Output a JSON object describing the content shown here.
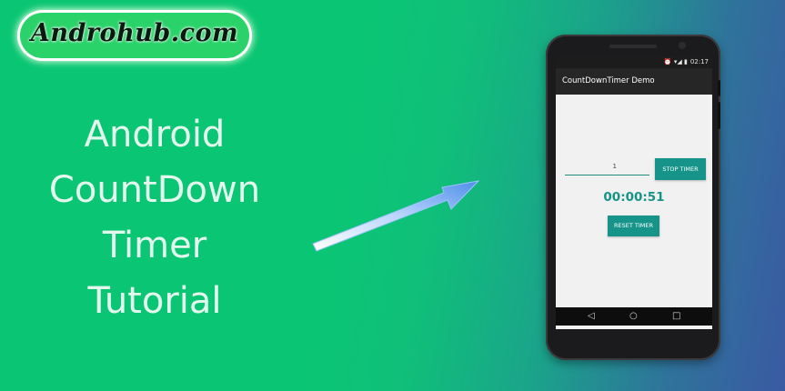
{
  "brand": {
    "logo_text": "Androhub.com"
  },
  "headline": {
    "lines": [
      "Android",
      "CountDown",
      "Timer",
      "Tutorial"
    ]
  },
  "phone": {
    "status_bar": {
      "icons": "⏰ ▾◢ ▮",
      "time": "02:17"
    },
    "app_title": "CountDownTimer Demo",
    "input": {
      "value": "1"
    },
    "stop_button_label": "STOP TIMER",
    "timer_display": "00:00:51",
    "reset_button_label": "RESET TIMER",
    "nav": {
      "back": "◁",
      "home": "○",
      "recents": "□"
    }
  },
  "colors": {
    "background": "#0ac674",
    "accent": "#17948a",
    "headline_text": "#e4f7ee"
  }
}
